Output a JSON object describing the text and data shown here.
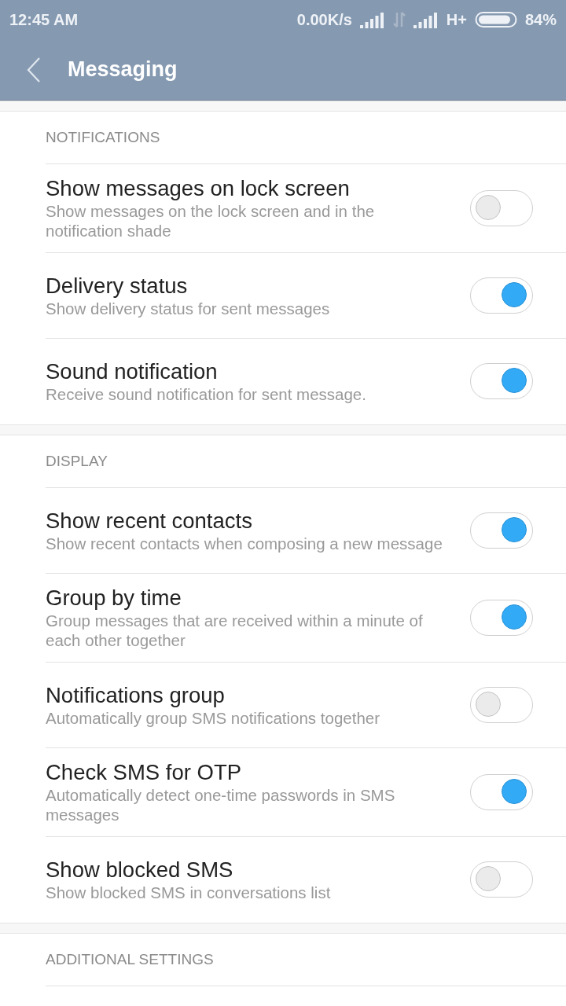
{
  "status_bar": {
    "time": "12:45 AM",
    "speed": "0.00K/s",
    "network": "H+",
    "battery": "84%"
  },
  "toolbar": {
    "title": "Messaging"
  },
  "sections": [
    {
      "header": "NOTIFICATIONS",
      "items": [
        {
          "title": "Show messages on lock screen",
          "subtitle": "Show messages on the lock screen and in the notification shade",
          "on": false
        },
        {
          "title": "Delivery status",
          "subtitle": "Show delivery status for sent messages",
          "on": true
        },
        {
          "title": "Sound notification",
          "subtitle": "Receive sound notification for sent message.",
          "on": true
        }
      ]
    },
    {
      "header": "DISPLAY",
      "items": [
        {
          "title": "Show recent contacts",
          "subtitle": "Show recent contacts when composing a new message",
          "on": true
        },
        {
          "title": "Group by time",
          "subtitle": "Group messages that are received within a minute of each other together",
          "on": true
        },
        {
          "title": "Notifications group",
          "subtitle": "Automatically group SMS notifications together",
          "on": false
        },
        {
          "title": "Check SMS for OTP",
          "subtitle": "Automatically detect one-time passwords in SMS messages",
          "on": true
        },
        {
          "title": "Show blocked SMS",
          "subtitle": "Show blocked SMS in conversations list",
          "on": false
        }
      ]
    },
    {
      "header": "ADDITIONAL SETTINGS"
    }
  ]
}
